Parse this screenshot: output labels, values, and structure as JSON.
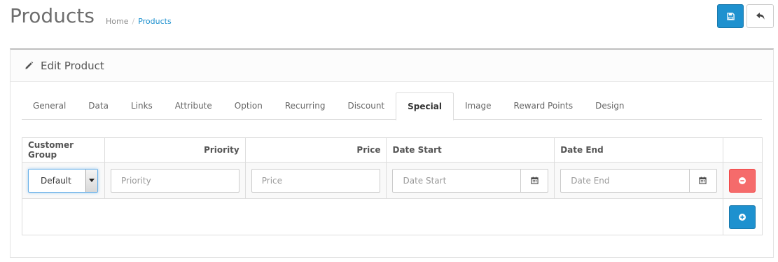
{
  "header": {
    "title": "Products",
    "breadcrumb": [
      "Home",
      "Products"
    ],
    "save_icon": "save-icon",
    "back_icon": "reply-icon"
  },
  "panel": {
    "heading_icon": "pencil-icon",
    "heading": "Edit Product"
  },
  "tabs": [
    {
      "label": "General"
    },
    {
      "label": "Data"
    },
    {
      "label": "Links"
    },
    {
      "label": "Attribute"
    },
    {
      "label": "Option"
    },
    {
      "label": "Recurring"
    },
    {
      "label": "Discount"
    },
    {
      "label": "Special",
      "active": true
    },
    {
      "label": "Image"
    },
    {
      "label": "Reward Points"
    },
    {
      "label": "Design"
    }
  ],
  "special_table": {
    "columns": [
      "Customer Group",
      "Priority",
      "Price",
      "Date Start",
      "Date End"
    ],
    "row": {
      "customer_group": "Default",
      "priority_placeholder": "Priority",
      "price_placeholder": "Price",
      "date_start_placeholder": "Date Start",
      "date_end_placeholder": "Date End"
    }
  },
  "colors": {
    "primary": "#1e91cf",
    "danger": "#f56b6b",
    "link": "#1e91cf"
  }
}
